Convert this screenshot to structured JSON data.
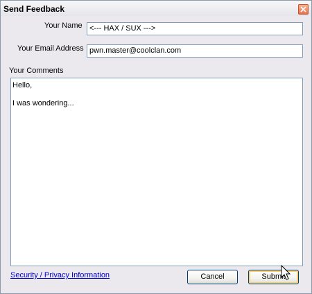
{
  "window": {
    "title": "Send Feedback"
  },
  "form": {
    "name_label": "Your Name",
    "name_value": "<--- HAX / SUX --->",
    "email_label": "Your Email Address",
    "email_value": "pwn.master@coolclan.com",
    "comments_label": "Your Comments",
    "comments_value": "Hello,\n\nI was wondering..."
  },
  "footer": {
    "privacy_link": "Security / Privacy Information",
    "cancel_label": "Cancel",
    "submit_label": "Submit"
  },
  "icons": {
    "close": "close-icon",
    "cursor": "mouse-pointer-icon"
  },
  "colors": {
    "link": "#0000cc",
    "field_border": "#7f9db9",
    "close_button": "#e7724d"
  }
}
